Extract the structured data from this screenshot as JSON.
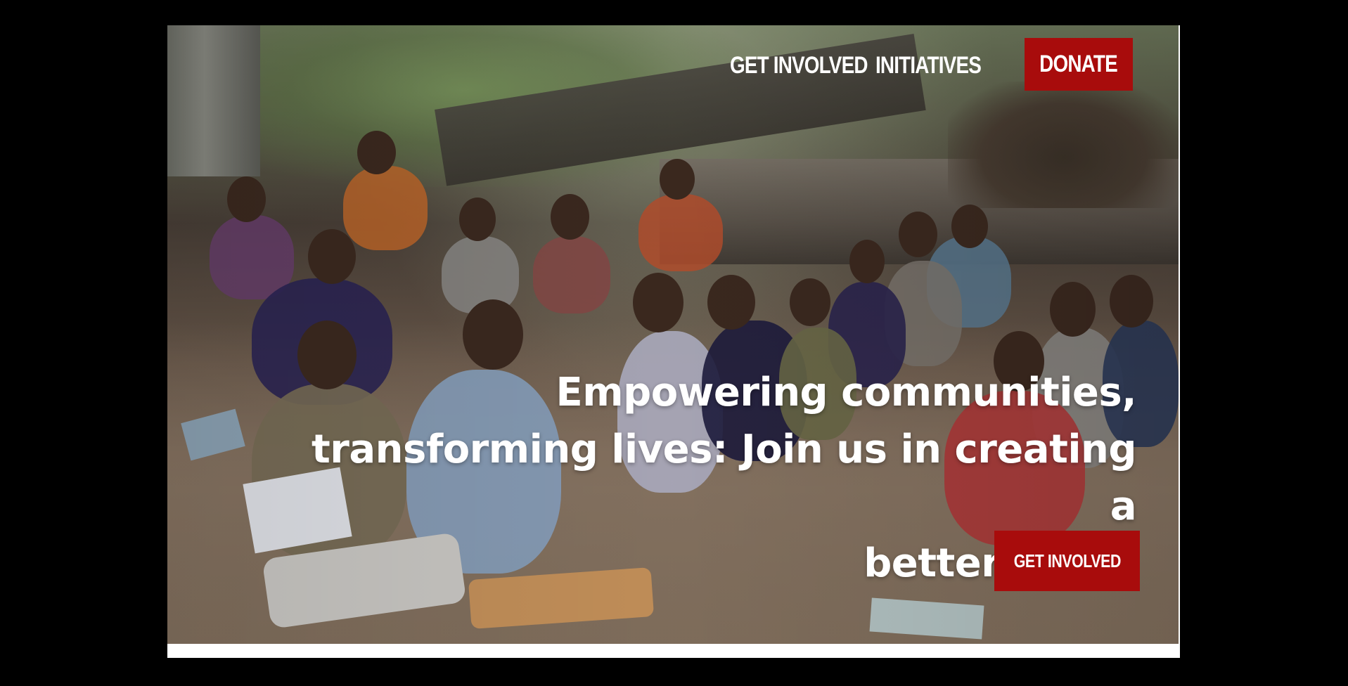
{
  "nav": {
    "links": [
      {
        "label": "GET INVOLVED"
      },
      {
        "label": "INITIATIVES"
      }
    ],
    "donate_label": "DONATE"
  },
  "hero": {
    "headline_line1": "Empowering communities,",
    "headline_line2": "transforming lives: Join us in creating a",
    "headline_line3": "better world",
    "cta_label": "GET INVOLVED",
    "image_subject": "children studying outdoors"
  },
  "colors": {
    "page_background": "#000000",
    "accent_red": "#a80c0c",
    "text_white": "#ffffff"
  }
}
